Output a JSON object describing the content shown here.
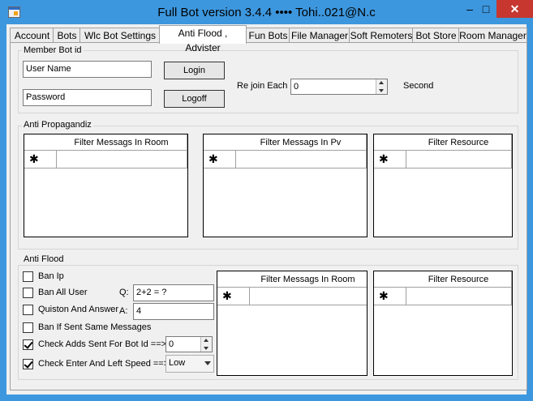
{
  "window": {
    "title": "Full Bot   version  3.4.4    ••••    Tohi..021@N.c",
    "minimize": "–",
    "maximize": "□",
    "close": "✕"
  },
  "tabs": [
    {
      "label": "Account"
    },
    {
      "label": "Bots"
    },
    {
      "label": "Wlc Bot Settings"
    },
    {
      "label": "Anti Flood , Advister"
    },
    {
      "label": "Fun Bots"
    },
    {
      "label": "File Manager"
    },
    {
      "label": "Soft Remoters"
    },
    {
      "label": "Bot Store"
    },
    {
      "label": "Room Manager"
    }
  ],
  "member": {
    "group_label": "Member Bot id",
    "username_value": "User Name",
    "password_value": "Password",
    "login": "Login",
    "logoff": "Logoff",
    "rejoin_label": "Re join Each",
    "rejoin_value": "0",
    "unit": "Second"
  },
  "propaganda": {
    "group_label": "Anti Propagandiz",
    "grid1_header": "Filter Messags In Room",
    "grid2_header": "Filter Messags In Pv",
    "grid3_header": "Filter Resource",
    "new_row_marker": "✱"
  },
  "flood": {
    "group_label": "Anti Flood",
    "ban_ip": "Ban Ip",
    "ban_all": "Ban All User",
    "question_answer": "Quiston And Answer",
    "ban_same": "Ban If Sent Same Messages",
    "check_adds": "Check Adds Sent For Bot Id ==>",
    "check_enter": "Check Enter And Left Speed ==>",
    "q_label": "Q:",
    "q_value": "2+2 = ?",
    "a_label": "A:",
    "a_value": "4",
    "adds_value": "0",
    "speed_value": "Low",
    "grid1_header": "Filter Messags In Room",
    "grid2_header": "Filter Resource",
    "new_row_marker": "✱"
  }
}
